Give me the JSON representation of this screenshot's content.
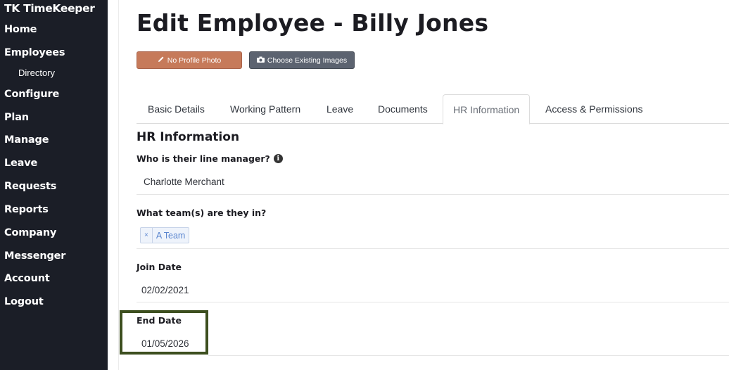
{
  "sidebar": {
    "logo": "TK TimeKeeper",
    "items": [
      {
        "label": "Home"
      },
      {
        "label": "Employees"
      },
      {
        "label": "Directory"
      },
      {
        "label": "Configure"
      },
      {
        "label": "Plan"
      },
      {
        "label": "Manage"
      },
      {
        "label": "Leave"
      },
      {
        "label": "Requests"
      },
      {
        "label": "Reports"
      },
      {
        "label": "Company"
      },
      {
        "label": "Messenger"
      },
      {
        "label": "Account"
      },
      {
        "label": "Logout"
      }
    ]
  },
  "page": {
    "title": "Edit Employee - Billy Jones",
    "photo_button": "No Profile Photo",
    "images_button": "Choose Existing Images"
  },
  "tabs": [
    {
      "label": "Basic Details"
    },
    {
      "label": "Working Pattern"
    },
    {
      "label": "Leave"
    },
    {
      "label": "Documents"
    },
    {
      "label": "HR Information",
      "active": true
    },
    {
      "label": "Access & Permissions"
    }
  ],
  "hr": {
    "section_title": "HR Information",
    "line_manager_label": "Who is their line manager?",
    "line_manager_value": "Charlotte Merchant",
    "teams_label": "What team(s) are they in?",
    "team_remove": "×",
    "team_tag": "A Team",
    "join_date_label": "Join Date",
    "join_date_value": "02/02/2021",
    "end_date_label": "End Date",
    "end_date_value": "01/05/2026"
  },
  "colors": {
    "sidebar_bg": "#1b1e27",
    "photo_button": "#c67a5a",
    "images_button": "#5c6370",
    "highlight": "#3d4f1f",
    "tag_text": "#5b86cf"
  }
}
